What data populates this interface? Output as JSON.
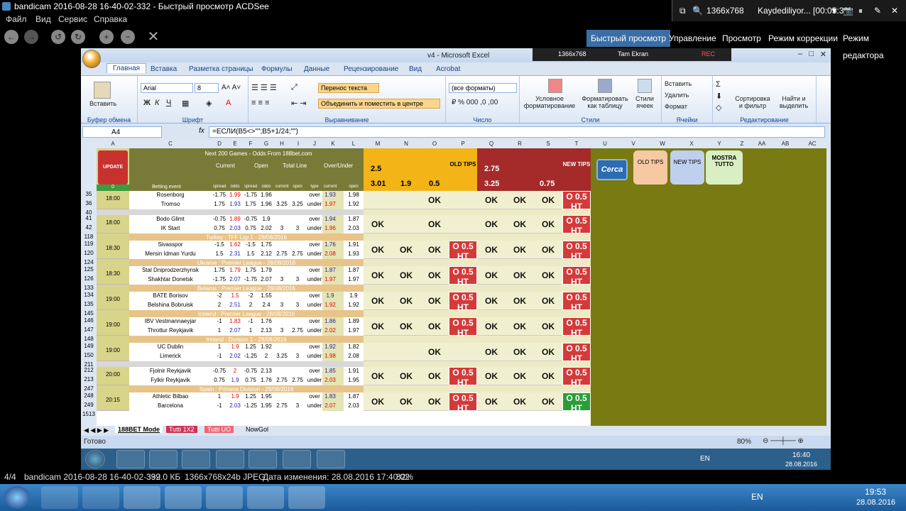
{
  "acdsee": {
    "title": "bandicam 2016-08-28 16-40-02-332 - Быстрый просмотр ACDSee",
    "menu": [
      "Файл",
      "Вид",
      "Сервис",
      "Справка"
    ],
    "modes": [
      "Быстрый просмотр",
      "Управление",
      "Просмотр",
      "Режим коррекции",
      "Режим редактора"
    ],
    "status": [
      "4/4",
      "bandicam 2016-08-28 16-40-02-332",
      "399.0 КБ",
      "1366x768x24b JPEG",
      "Дата изменения: 28.08.2016 17:40:02",
      "82%"
    ]
  },
  "bandicam": {
    "res": "1366x768",
    "rec": "Kaydediliyor... [00:05:33]"
  },
  "excel": {
    "title": "v4 - Microsoft Excel",
    "rec_bar": {
      "res": "1366x768",
      "mode": "Tam Ekran",
      "rec": "REC"
    },
    "tabs": [
      "Главная",
      "Вставка",
      "Разметка страницы",
      "Формулы",
      "Данные",
      "Рецензирование",
      "Вид",
      "Acrobat"
    ],
    "groups": [
      "Буфер обмена",
      "Шрифт",
      "Выравнивание",
      "Число",
      "Стили",
      "Ячейки",
      "Редактирование"
    ],
    "ribbon": {
      "paste": "Вставить",
      "font": "Arial",
      "size": "8",
      "wrap": "Перенос текста",
      "merge": "Объединить и поместить в центре",
      "numfmt": "(все форматы)",
      "cond": "Условное форматирование",
      "fmt_table": "Форматировать как таблицу",
      "styles": "Стили ячеек",
      "insert": "Вставить",
      "delete": "Удалить",
      "format": "Формат",
      "sort": "Сортировка и фильтр",
      "find": "Найти и выделить"
    },
    "namebox": "A4",
    "formula": "=ЕСЛИ(B5<>\"\";B5+1/24;\"\")",
    "columns": [
      "A",
      "C",
      "D",
      "E",
      "F",
      "G",
      "H",
      "I",
      "J",
      "K",
      "L",
      "M",
      "N",
      "O",
      "P",
      "Q",
      "R",
      "S",
      "T",
      "U",
      "V",
      "W",
      "X",
      "Y",
      "Z",
      "AA",
      "AB",
      "AC"
    ],
    "header": {
      "title": "Next 200 Games - Odds From 188bet.com",
      "current": "Current",
      "open": "Open",
      "total": "Total Line",
      "ou": "Over/Under",
      "betting": "Betting event",
      "sub": [
        "spread",
        "odds",
        "spread",
        "odds",
        "current",
        "open",
        "type",
        "current",
        "open"
      ],
      "update": "UPDATE",
      "zero": "0",
      "m_top": "2.5",
      "q_top": "2.75",
      "m_bot": "3.01",
      "n_bot": "1.9",
      "o_bot": "0.5",
      "q_bot": "3.25",
      "s_bot": "0.75",
      "old": "OLD TIPS",
      "new": "NEW TIPS",
      "btns": [
        "Cerca",
        "OLD TIPS",
        "NEW TIPS",
        "MOSTRA TUTTO"
      ]
    },
    "rows": [
      {
        "type": "game",
        "r1": "35",
        "r2": "36",
        "time": "18:00",
        "t1": "Rosenborg",
        "t2": "Tromso",
        "a": [
          "-1.75",
          "1.99",
          "-1.75",
          "1.96",
          "",
          "",
          "over",
          "1.93",
          "1.98"
        ],
        "b": [
          "1.75",
          "1.93",
          "1.75",
          "1.96",
          "3.25",
          "3.25",
          "under",
          "1.97",
          "1.92"
        ],
        "ok": [
          "",
          "",
          "OK",
          "",
          "OK",
          "OK",
          "OK"
        ],
        "tip": "O 0.5 HT"
      },
      {
        "type": "sep",
        "r": "40"
      },
      {
        "type": "game",
        "r1": "41",
        "r2": "42",
        "time": "18:00",
        "t1": "Bodo Glimt",
        "t2": "IK Start",
        "a": [
          "-0.75",
          "1.89",
          "-0.75",
          "1.9",
          "",
          "",
          "over",
          "1.94",
          "1.87"
        ],
        "b": [
          "0.75",
          "2.03",
          "0.75",
          "2.02",
          "3",
          "3",
          "under",
          "1.96",
          "2.03"
        ],
        "ok": [
          "OK",
          "",
          "OK",
          "",
          "OK",
          "OK",
          "OK"
        ],
        "tip": "O 0.5 HT"
      },
      {
        "type": "league",
        "r": "118",
        "text": "Turkey : TFF Ligi 1 - 28/08/2016"
      },
      {
        "type": "game",
        "r1": "119",
        "r2": "120",
        "time": "18:30",
        "t1": "Sivasspor",
        "t2": "Mersin Idman Yurdu",
        "a": [
          "-1.5",
          "1.62",
          "-1.5",
          "1.75",
          "",
          "",
          "over",
          "1.76",
          "1.91"
        ],
        "b": [
          "1.5",
          "2.31",
          "1.5",
          "2.12",
          "2.75",
          "2.75",
          "under",
          "2.08",
          "1.93"
        ],
        "ok": [
          "OK",
          "OK",
          "OK",
          "O 0.5 HT",
          "OK",
          "OK",
          "OK"
        ],
        "tip": "O 0.5 HT"
      },
      {
        "type": "league",
        "r": "124",
        "text": "Ukraine : Premier League - 28/08/2016"
      },
      {
        "type": "game",
        "r1": "125",
        "r2": "126",
        "time": "18:30",
        "t1": "Stal Dniprodzerzhynsk",
        "t2": "Shakhtar Donetsk",
        "a": [
          "1.75",
          "1.79",
          "1.75",
          "1.79",
          "",
          "",
          "over",
          "1.87",
          "1.87"
        ],
        "b": [
          "-1.75",
          "2.07",
          "-1.75",
          "2.07",
          "3",
          "3",
          "under",
          "1.97",
          "1.97"
        ],
        "ok": [
          "OK",
          "OK",
          "OK",
          "O 0.5 HT",
          "OK",
          "OK",
          "OK"
        ],
        "tip": "O 0.5 HT"
      },
      {
        "type": "league",
        "r": "133",
        "text": "Belarus : Premier League - 28/08/2016"
      },
      {
        "type": "game",
        "r1": "134",
        "r2": "135",
        "time": "19:00",
        "t1": "BATE Borisov",
        "t2": "Belshina Bobruisk",
        "a": [
          "-2",
          "1.5",
          "-2",
          "1.55",
          "",
          "",
          "over",
          "1.9",
          "1.9"
        ],
        "b": [
          "2",
          "2.51",
          "2",
          "2.4",
          "3",
          "3",
          "under",
          "1.92",
          "1.92"
        ],
        "ok": [
          "OK",
          "OK",
          "OK",
          "O 0.5 HT",
          "OK",
          "OK",
          "OK"
        ],
        "tip": "O 0.5 HT"
      },
      {
        "type": "league",
        "r": "145",
        "text": "Iceland : Premier League - 28/08/2016"
      },
      {
        "type": "game",
        "r1": "146",
        "r2": "147",
        "time": "19:00",
        "t1": "IBV Vestmannaeyjar",
        "t2": "Throttur Reykjavik",
        "a": [
          "-1",
          "1.83",
          "-1",
          "1.76",
          "",
          "",
          "over",
          "1.86",
          "1.89"
        ],
        "b": [
          "1",
          "2.07",
          "1",
          "2.13",
          "3",
          "2.75",
          "under",
          "2.02",
          "1.97"
        ],
        "ok": [
          "OK",
          "OK",
          "OK",
          "O 0.5 HT",
          "OK",
          "OK",
          "OK"
        ],
        "tip": "O 0.5 HT"
      },
      {
        "type": "league",
        "r": "148",
        "text": "Ireland : Division 1 - 28/08/2016"
      },
      {
        "type": "game",
        "r1": "149",
        "r2": "150",
        "time": "19:00",
        "t1": "UC Dublin",
        "t2": "Limerick",
        "a": [
          "1",
          "1.9",
          "1.25",
          "1.92",
          "",
          "",
          "over",
          "1.92",
          "1.82"
        ],
        "b": [
          "-1",
          "2.02",
          "-1.25",
          "2",
          "3.25",
          "3",
          "under",
          "1.98",
          "2.08"
        ],
        "ok": [
          "",
          "",
          "OK",
          "",
          "OK",
          "OK",
          "OK"
        ],
        "tip": "O 0.5 HT"
      },
      {
        "type": "sep",
        "r": "211"
      },
      {
        "type": "game",
        "r1": "212",
        "r2": "213",
        "time": "20:00",
        "t1": "Fjolnir Reykjavik",
        "t2": "Fylkir Reykjavik",
        "a": [
          "-0.75",
          "2",
          "-0.75",
          "2.13",
          "",
          "",
          "over",
          "1.85",
          "1.91"
        ],
        "b": [
          "0.75",
          "1.9",
          "0.75",
          "1.76",
          "2.75",
          "2.75",
          "under",
          "2.03",
          "1.95"
        ],
        "ok": [
          "OK",
          "OK",
          "OK",
          "O 0.5 HT",
          "OK",
          "OK",
          "OK"
        ],
        "tip": "O 0.5 HT"
      },
      {
        "type": "league",
        "r": "247",
        "text": "Spain : Primera Division - 28/08/2016"
      },
      {
        "type": "game",
        "r1": "248",
        "r2": "249",
        "time": "20:15",
        "t1": "Athletic Bilbao",
        "t2": "Barcelona",
        "a": [
          "1",
          "1.9",
          "1.25",
          "1.95",
          "",
          "",
          "over",
          "1.83",
          "1.87"
        ],
        "b": [
          "-1",
          "2.03",
          "-1.25",
          "1.95",
          "2.75",
          "3",
          "under",
          "2.07",
          "2.03"
        ],
        "ok": [
          "OK",
          "OK",
          "OK",
          "O 0.5 HT",
          "OK",
          "OK",
          "OK"
        ],
        "tip": "O 0.5 HT",
        "green": true
      }
    ],
    "last_row": "1513",
    "sheets": [
      "188BET Mode",
      "Tutti 1X2",
      "Tutti UO",
      "NowGol"
    ],
    "status_ready": "Готово",
    "zoom": "80%",
    "win_time": "16:40",
    "win_date": "28.08.2016",
    "win_lang": "EN"
  },
  "taskbar": {
    "lang": "EN",
    "time": "19:53",
    "date": "28.08.2016"
  }
}
